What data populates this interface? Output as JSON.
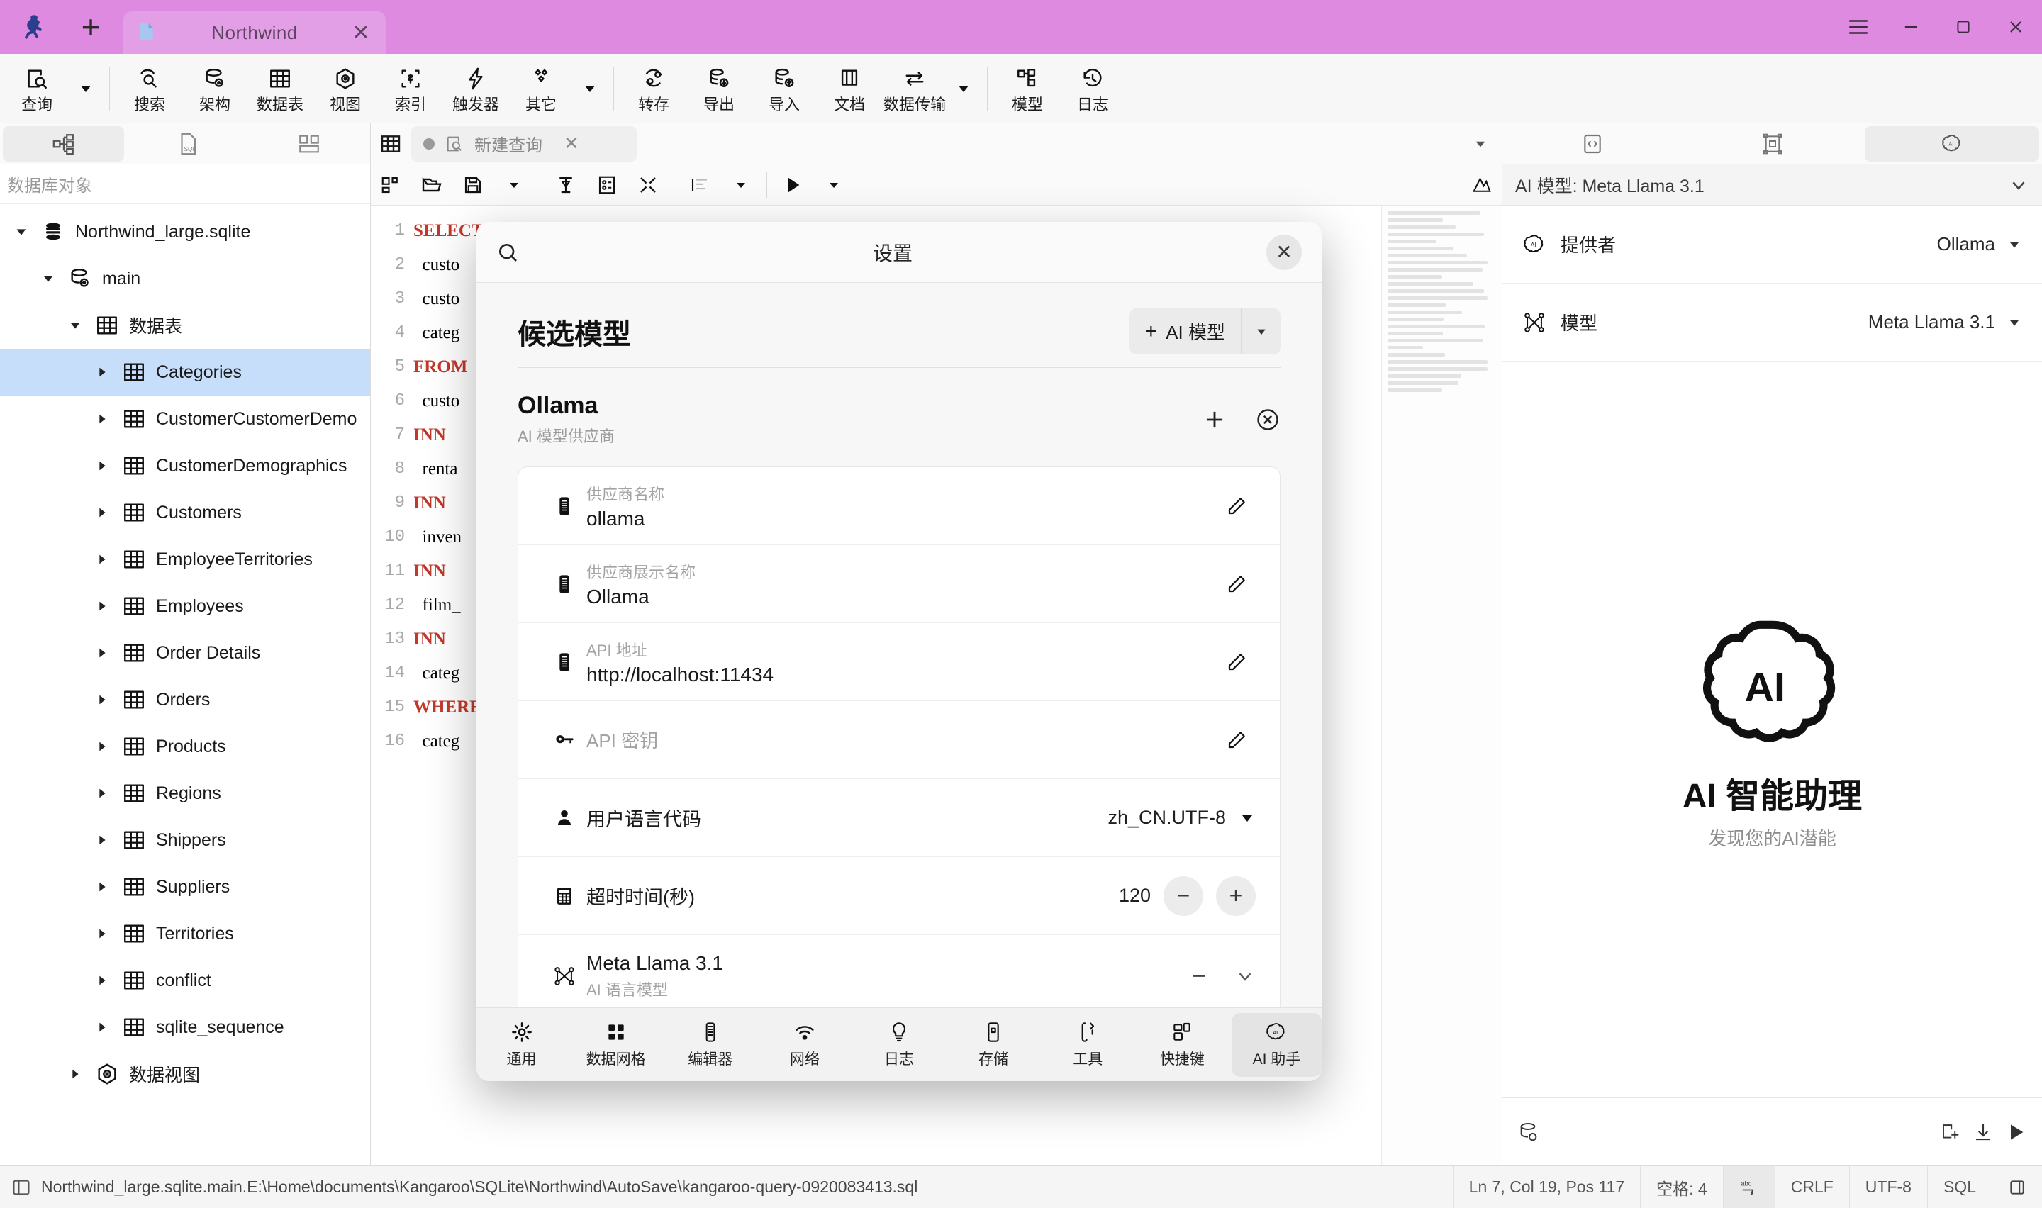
{
  "titlebar": {
    "logo": "kangaroo-logo-icon",
    "new_tab_label": "+",
    "tab": {
      "title": "Northwind",
      "icon": "database-file-icon",
      "close": "✕"
    },
    "window": {
      "menu": "≡",
      "minimize": "–",
      "maximize": "▢",
      "close": "✕"
    }
  },
  "toolbar": {
    "items": [
      {
        "label": "查询",
        "icon": "query-icon",
        "has_caret": true
      },
      {
        "label": "搜索",
        "icon": "search-icon"
      },
      {
        "label": "架构",
        "icon": "schema-icon"
      },
      {
        "label": "数据表",
        "icon": "table-icon"
      },
      {
        "label": "视图",
        "icon": "view-icon"
      },
      {
        "label": "索引",
        "icon": "index-icon"
      },
      {
        "label": "触发器",
        "icon": "trigger-icon"
      },
      {
        "label": "其它",
        "icon": "other-icon",
        "has_caret": true
      },
      {
        "label": "转存",
        "icon": "dump-icon"
      },
      {
        "label": "导出",
        "icon": "export-icon"
      },
      {
        "label": "导入",
        "icon": "import-icon"
      },
      {
        "label": "文档",
        "icon": "document-icon"
      },
      {
        "label": "数据传输",
        "icon": "data-transfer-icon",
        "has_caret": true
      },
      {
        "label": "模型",
        "icon": "model-icon"
      },
      {
        "label": "日志",
        "icon": "log-icon"
      }
    ]
  },
  "sidebar": {
    "tabs": [
      {
        "icon": "object-tree-icon",
        "active": true
      },
      {
        "icon": "sql-file-icon",
        "active": false
      },
      {
        "icon": "layout-icon",
        "active": false
      }
    ],
    "header": "数据库对象",
    "tree": [
      {
        "label": "Northwind_large.sqlite",
        "icon": "database-icon",
        "depth": 0,
        "twisty": "down",
        "selected": false
      },
      {
        "label": "main",
        "icon": "schema-icon",
        "depth": 1,
        "twisty": "down",
        "selected": false
      },
      {
        "label": "数据表",
        "icon": "table-icon",
        "depth": 2,
        "twisty": "down",
        "selected": false
      },
      {
        "label": "Categories",
        "icon": "table-icon",
        "depth": 3,
        "twisty": "right",
        "selected": true
      },
      {
        "label": "CustomerCustomerDemo",
        "icon": "table-icon",
        "depth": 3,
        "twisty": "right",
        "selected": false
      },
      {
        "label": "CustomerDemographics",
        "icon": "table-icon",
        "depth": 3,
        "twisty": "right",
        "selected": false
      },
      {
        "label": "Customers",
        "icon": "table-icon",
        "depth": 3,
        "twisty": "right",
        "selected": false
      },
      {
        "label": "EmployeeTerritories",
        "icon": "table-icon",
        "depth": 3,
        "twisty": "right",
        "selected": false
      },
      {
        "label": "Employees",
        "icon": "table-icon",
        "depth": 3,
        "twisty": "right",
        "selected": false
      },
      {
        "label": "Order Details",
        "icon": "table-icon",
        "depth": 3,
        "twisty": "right",
        "selected": false
      },
      {
        "label": "Orders",
        "icon": "table-icon",
        "depth": 3,
        "twisty": "right",
        "selected": false
      },
      {
        "label": "Products",
        "icon": "table-icon",
        "depth": 3,
        "twisty": "right",
        "selected": false
      },
      {
        "label": "Regions",
        "icon": "table-icon",
        "depth": 3,
        "twisty": "right",
        "selected": false
      },
      {
        "label": "Shippers",
        "icon": "table-icon",
        "depth": 3,
        "twisty": "right",
        "selected": false
      },
      {
        "label": "Suppliers",
        "icon": "table-icon",
        "depth": 3,
        "twisty": "right",
        "selected": false
      },
      {
        "label": "Territories",
        "icon": "table-icon",
        "depth": 3,
        "twisty": "right",
        "selected": false
      },
      {
        "label": "conflict",
        "icon": "table-icon",
        "depth": 3,
        "twisty": "right",
        "selected": false
      },
      {
        "label": "sqlite_sequence",
        "icon": "table-icon",
        "depth": 3,
        "twisty": "right",
        "selected": false
      },
      {
        "label": "数据视图",
        "icon": "view-icon",
        "depth": 2,
        "twisty": "right",
        "selected": false
      }
    ]
  },
  "editor": {
    "tab": {
      "title": "新建查询",
      "icon": "query-icon",
      "dirty_dot": true,
      "close": "✕"
    },
    "toolbar_icons": [
      "new-query-icon",
      "open-folder-icon",
      "save-icon",
      "caret-down-icon",
      "beautify-icon",
      "explain-icon",
      "collapse-icon",
      "format-icon",
      "caret-down-icon"
    ],
    "lines": [
      {
        "n": "1",
        "kw": "SELECT",
        "rest": ""
      },
      {
        "n": "2",
        "kw": "",
        "rest": "custo"
      },
      {
        "n": "3",
        "kw": "",
        "rest": "custo"
      },
      {
        "n": "4",
        "kw": "",
        "rest": "categ"
      },
      {
        "n": "5",
        "kw": "FROM",
        "rest": ""
      },
      {
        "n": "6",
        "kw": "",
        "rest": "custo"
      },
      {
        "n": "7",
        "kw": "INN",
        "rest": ""
      },
      {
        "n": "8",
        "kw": "",
        "rest": "renta"
      },
      {
        "n": "9",
        "kw": "INN",
        "rest": ""
      },
      {
        "n": "10",
        "kw": "",
        "rest": "inven"
      },
      {
        "n": "11",
        "kw": "INN",
        "rest": ""
      },
      {
        "n": "12",
        "kw": "",
        "rest": "film_"
      },
      {
        "n": "13",
        "kw": "INN",
        "rest": ""
      },
      {
        "n": "14",
        "kw": "",
        "rest": "categ"
      },
      {
        "n": "15",
        "kw": "WHERE",
        "rest": ""
      },
      {
        "n": "16",
        "kw": "",
        "rest": "categ"
      }
    ]
  },
  "ai_panel": {
    "tabs": [
      {
        "icon": "code-icon",
        "active": false
      },
      {
        "icon": "structure-icon",
        "active": false
      },
      {
        "icon": "ai-icon",
        "active": true
      }
    ],
    "model_bar": "AI 模型: Meta Llama 3.1",
    "rows": [
      {
        "label": "提供者",
        "value": "Ollama",
        "icon": "ai-icon"
      },
      {
        "label": "模型",
        "value": "Meta Llama 3.1",
        "icon": "model-node-icon"
      }
    ],
    "hero": {
      "title": "AI 智能助理",
      "subtitle": "发现您的AI潜能",
      "icon": "ai-brain-icon"
    },
    "input": {
      "placeholder": "",
      "icons": [
        "attach-db-icon",
        "new-chat-icon",
        "download-icon",
        "send-icon"
      ]
    }
  },
  "statusbar": {
    "path": "Northwind_large.sqlite.main.E:\\Home\\documents\\Kangaroo\\SQLite\\Northwind\\AutoSave\\kangaroo-query-0920083413.sql",
    "cells": [
      {
        "text": "Ln 7, Col 19, Pos 117",
        "active": false
      },
      {
        "text": "空格: 4",
        "active": false
      },
      {
        "text": "abc-wrap-icon",
        "active": true,
        "is_icon": true
      },
      {
        "text": "CRLF",
        "active": false
      },
      {
        "text": "UTF-8",
        "active": false
      },
      {
        "text": "SQL",
        "active": false
      },
      {
        "text": "panel-icon",
        "active": false,
        "is_icon": true
      }
    ]
  },
  "settings_dialog": {
    "title": "设置",
    "search_icon": "search-icon",
    "close": "✕",
    "section_title": "候选模型",
    "add_button": {
      "label": "AI 模型",
      "plus": "+",
      "caret": "▼"
    },
    "provider": {
      "name": "Ollama",
      "subtitle": "AI 模型供应商",
      "actions": [
        "add-icon",
        "remove-icon"
      ]
    },
    "fields": [
      {
        "label": "供应商名称",
        "value": "ollama",
        "icon": "text-field-icon",
        "edit": "pencil-icon"
      },
      {
        "label": "供应商展示名称",
        "value": "Ollama",
        "icon": "text-field-icon",
        "edit": "pencil-icon"
      },
      {
        "label": "API 地址",
        "value": "http://localhost:11434",
        "icon": "text-field-icon",
        "edit": "pencil-icon"
      },
      {
        "label": "API 密钥",
        "value": "",
        "icon": "key-icon",
        "edit": "pencil-icon"
      }
    ],
    "lang_row": {
      "label": "用户语言代码",
      "value": "zh_CN.UTF-8",
      "icon": "user-icon",
      "caret": "▼"
    },
    "timeout_row": {
      "label": "超时时间(秒)",
      "value": "120",
      "icon": "calculator-icon",
      "minus": "−",
      "plus": "+"
    },
    "model_row": {
      "name": "Meta Llama 3.1",
      "subtitle": "AI 语言模型",
      "icon": "model-node-icon",
      "minus": "−",
      "caret": "⌄"
    },
    "tabs": [
      {
        "label": "通用",
        "icon": "gear-icon",
        "active": false
      },
      {
        "label": "数据网格",
        "icon": "grid-icon",
        "active": false
      },
      {
        "label": "编辑器",
        "icon": "editor-icon",
        "active": false
      },
      {
        "label": "网络",
        "icon": "wifi-icon",
        "active": false
      },
      {
        "label": "日志",
        "icon": "bulb-icon",
        "active": false
      },
      {
        "label": "存储",
        "icon": "storage-icon",
        "active": false
      },
      {
        "label": "工具",
        "icon": "tools-icon",
        "active": false
      },
      {
        "label": "快捷键",
        "icon": "shortcut-icon",
        "active": false
      },
      {
        "label": "AI 助手",
        "icon": "ai-icon",
        "active": true
      }
    ]
  },
  "colors": {
    "titlebar": "#dd8ae0",
    "selection": "#c7defa",
    "keyword": "#c0392b",
    "accent": "#2f6fb5"
  }
}
